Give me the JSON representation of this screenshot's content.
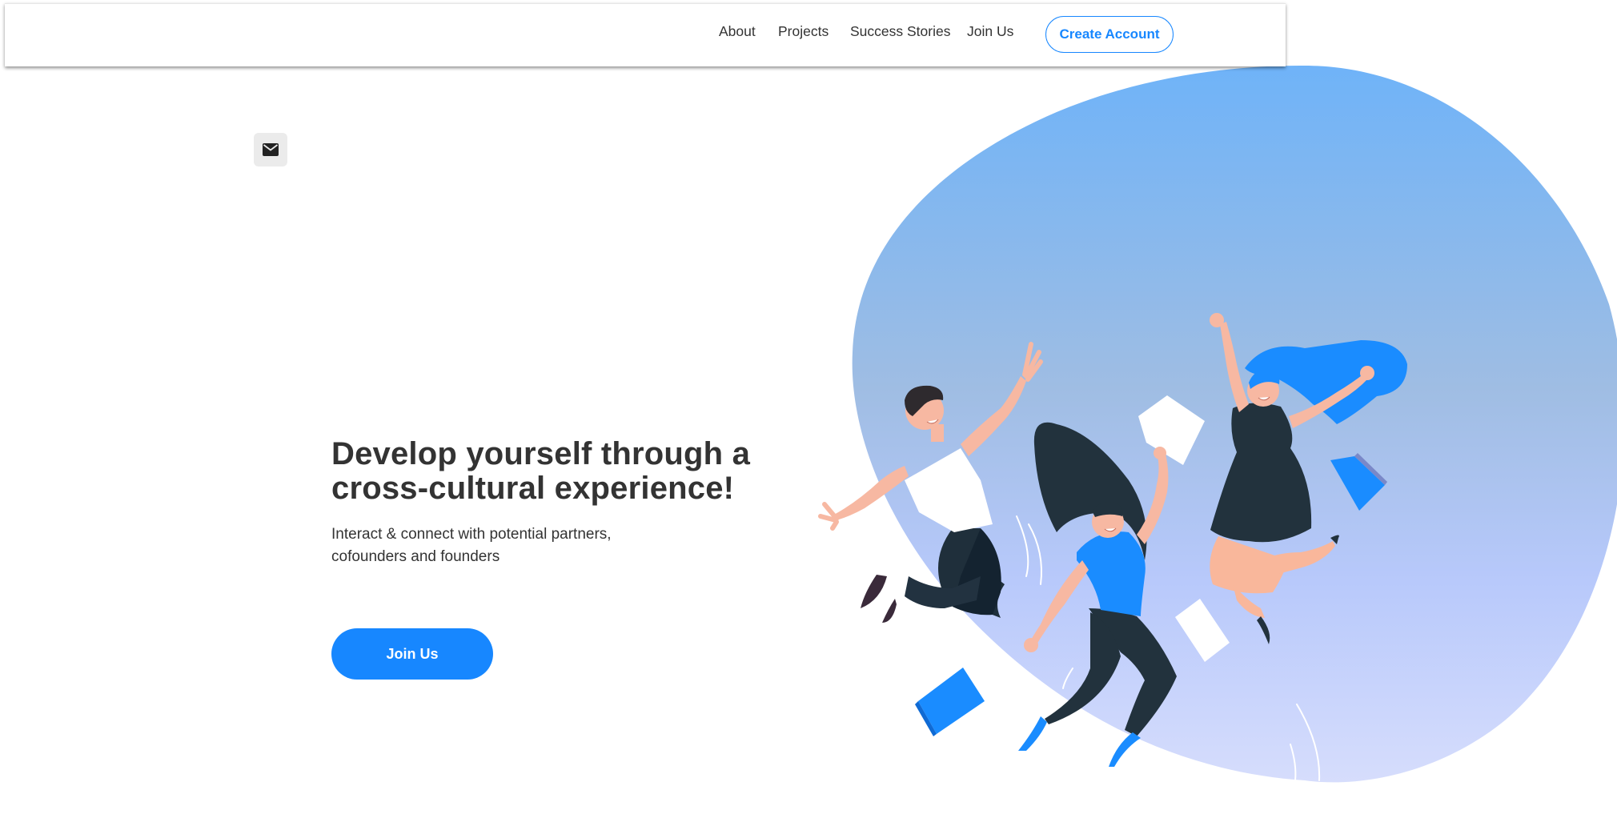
{
  "header": {
    "nav": {
      "about": "About",
      "projects": "Projects",
      "success_stories": "Success Stories",
      "join_us": "Join Us"
    },
    "create_account": "Create Account"
  },
  "contact": {
    "icon": "mail-icon"
  },
  "hero": {
    "title": "Develop yourself through a cross-cultural experience!",
    "subtitle": "Interact & connect with potential partners, cofounders and founders",
    "cta": "Join Us",
    "illustration": "three-people-jumping-illustration"
  },
  "colors": {
    "accent": "#1787ff",
    "text": "#333333",
    "blob_top": "#6fb3f8",
    "blob_bottom": "#d6ddfc"
  }
}
